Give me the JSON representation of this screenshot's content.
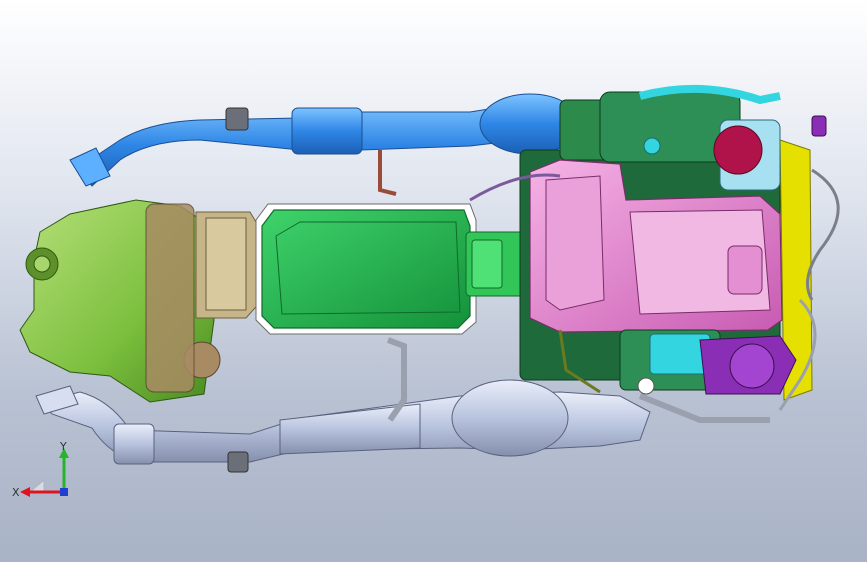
{
  "viewport": {
    "background_top": "#ffffff",
    "background_bottom": "#a9b3c6"
  },
  "model": {
    "colors": {
      "exhaust_blue": "#2f86e6",
      "exhaust_silver": "#b8c3de",
      "transfer_case_green": "#7bbf3d",
      "transmission_khaki": "#c7b58a",
      "oil_pan_green": "#1fb04a",
      "engine_pink": "#e07fc9",
      "turbo_red": "#b0124a",
      "turbo_purple": "#8a2fb5",
      "yellow_frame": "#e6e000",
      "cyan_part": "#33d6e0",
      "dark_green_block": "#1f6a3a"
    }
  },
  "triad": {
    "x_label": "X",
    "y_label": "Y",
    "x_color": "#e0141e",
    "y_color": "#27b32a",
    "z_color": "#1f3fcf"
  }
}
